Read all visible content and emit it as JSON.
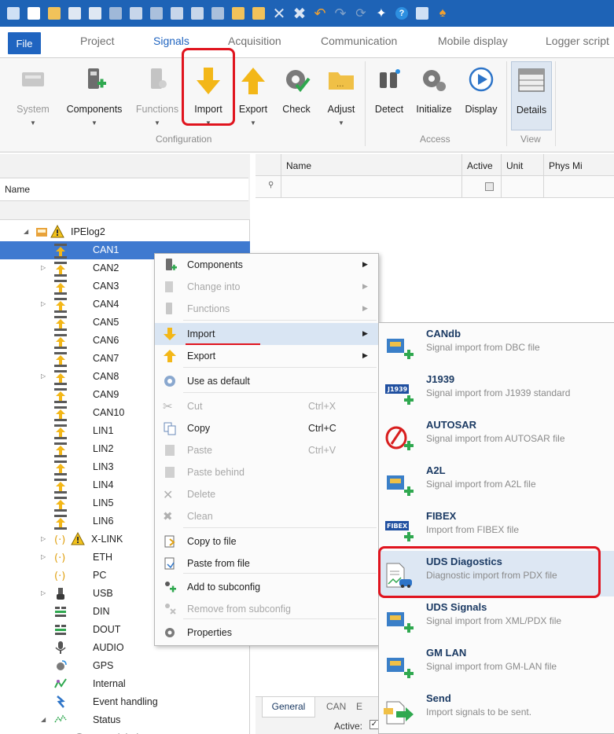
{
  "ribbon_tabs": [
    "File",
    "Project",
    "Signals",
    "Acquisition",
    "Communication",
    "Mobile display",
    "Logger script"
  ],
  "ribbon": {
    "buttons": [
      {
        "label": "System",
        "disabled": true
      },
      {
        "label": "Components",
        "disabled": false
      },
      {
        "label": "Functions",
        "disabled": true
      },
      {
        "label": "Import",
        "disabled": false
      },
      {
        "label": "Export",
        "disabled": false
      },
      {
        "label": "Check",
        "disabled": false
      },
      {
        "label": "Adjust",
        "disabled": false
      },
      {
        "label": "Detect",
        "disabled": false
      },
      {
        "label": "Initialize",
        "disabled": false
      },
      {
        "label": "Display",
        "disabled": false
      },
      {
        "label": "Details",
        "disabled": false
      }
    ],
    "groups": [
      "Configuration",
      "Access",
      "View"
    ]
  },
  "tree": {
    "header": "Name",
    "root": "IPElog2",
    "items": [
      "CAN1",
      "CAN2",
      "CAN3",
      "CAN4",
      "CAN5",
      "CAN6",
      "CAN7",
      "CAN8",
      "CAN9",
      "CAN10",
      "LIN1",
      "LIN2",
      "LIN3",
      "LIN4",
      "LIN5",
      "LIN6",
      "X-LINK",
      "ETH",
      "PC",
      "USB",
      "DIN",
      "DOUT",
      "AUDIO",
      "GPS",
      "Internal",
      "Event handling",
      "Status",
      "Global"
    ],
    "selected": "CAN1"
  },
  "grid": {
    "columns": [
      "Name",
      "Active",
      "Unit",
      "Phys Mi"
    ],
    "bottom_tabs": [
      "General",
      "CAN",
      "E"
    ],
    "active_label": "Active:"
  },
  "context_menu": [
    {
      "label": "Components",
      "shortcut": "",
      "disabled": false,
      "submenu": true
    },
    {
      "label": "Change into",
      "shortcut": "",
      "disabled": true,
      "submenu": true
    },
    {
      "label": "Functions",
      "shortcut": "",
      "disabled": true,
      "submenu": true
    },
    {
      "label": "Import",
      "shortcut": "",
      "disabled": false,
      "submenu": true
    },
    {
      "label": "Export",
      "shortcut": "",
      "disabled": false,
      "submenu": true
    },
    {
      "label": "Use as default",
      "shortcut": "",
      "disabled": false,
      "submenu": false
    },
    {
      "label": "Cut",
      "shortcut": "Ctrl+X",
      "disabled": true,
      "submenu": false
    },
    {
      "label": "Copy",
      "shortcut": "Ctrl+C",
      "disabled": false,
      "submenu": false
    },
    {
      "label": "Paste",
      "shortcut": "Ctrl+V",
      "disabled": true,
      "submenu": false
    },
    {
      "label": "Paste behind",
      "shortcut": "",
      "disabled": true,
      "submenu": false
    },
    {
      "label": "Delete",
      "shortcut": "",
      "disabled": true,
      "submenu": false
    },
    {
      "label": "Clean",
      "shortcut": "",
      "disabled": true,
      "submenu": false
    },
    {
      "label": "Copy to file",
      "shortcut": "",
      "disabled": false,
      "submenu": false
    },
    {
      "label": "Paste from file",
      "shortcut": "",
      "disabled": false,
      "submenu": false
    },
    {
      "label": "Add to subconfig",
      "shortcut": "",
      "disabled": false,
      "submenu": false
    },
    {
      "label": "Remove from subconfig",
      "shortcut": "",
      "disabled": true,
      "submenu": false
    },
    {
      "label": "Properties",
      "shortcut": "",
      "disabled": false,
      "submenu": false
    }
  ],
  "import_submenu": [
    {
      "title": "CANdb",
      "desc": "Signal import from DBC file"
    },
    {
      "title": "J1939",
      "desc": "Signal import from J1939 standard"
    },
    {
      "title": "AUTOSAR",
      "desc": "Signal import from AUTOSAR file"
    },
    {
      "title": "A2L",
      "desc": "Signal import from A2L file"
    },
    {
      "title": "FIBEX",
      "desc": "Import from FIBEX file"
    },
    {
      "title": "UDS Diagostics",
      "desc": "Diagnostic import from PDX file"
    },
    {
      "title": "UDS Signals",
      "desc": "Signal import from XML/PDX file"
    },
    {
      "title": "GM LAN",
      "desc": "Signal import from GM-LAN file"
    },
    {
      "title": "Send",
      "desc": "Import signals to be sent."
    }
  ],
  "icon_badges": {
    "j1939": "J1939",
    "fibex": "FIBEX"
  },
  "colors": {
    "brand": "#1e63b6",
    "selection": "#3f7ad0",
    "highlight_box": "#e0141e"
  }
}
